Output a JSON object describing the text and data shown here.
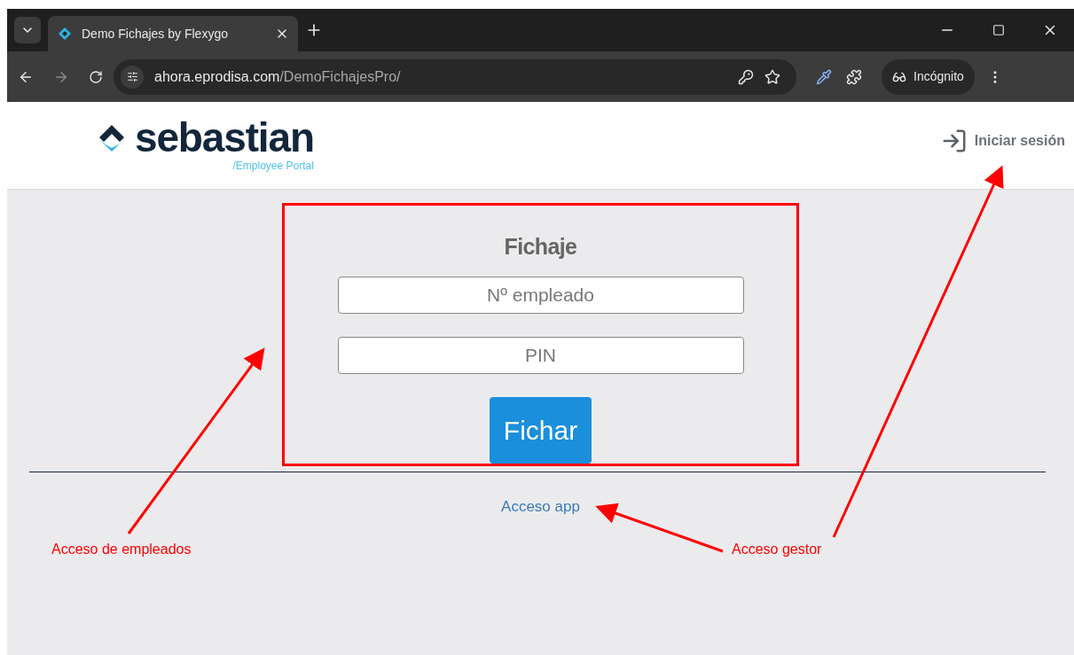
{
  "browser": {
    "tab": {
      "title": "Demo Fichajes by Flexygo",
      "selected": true
    },
    "url_host": "ahora.eprodisa.com",
    "url_path": "/DemoFichajesPro/",
    "profile": "Incógnito"
  },
  "header": {
    "logo": {
      "name": "sebastian",
      "subtitle": "/Employee Portal"
    },
    "login": "Iniciar sesión"
  },
  "form": {
    "title": "Fichaje",
    "fields": [
      {
        "placeholder": "Nº empleado"
      },
      {
        "placeholder": "PIN"
      }
    ],
    "button": "Fichar"
  },
  "footer_link": "Acceso app",
  "annotations": [
    {
      "text": "Acceso de empleados"
    },
    {
      "text": "Acceso gestor"
    }
  ]
}
